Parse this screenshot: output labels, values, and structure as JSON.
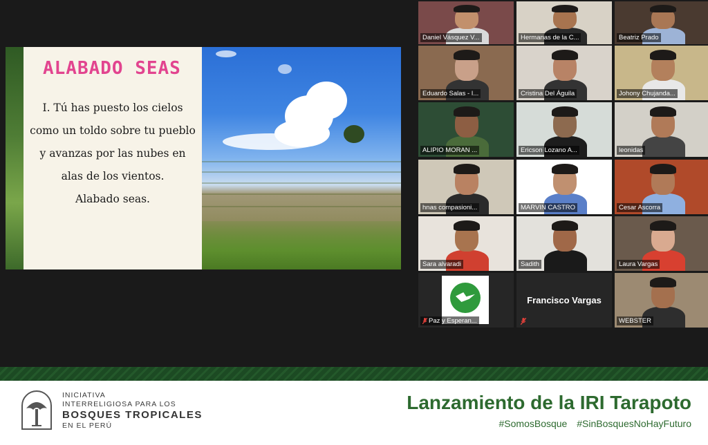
{
  "slide": {
    "title": "ALABADO SEAS",
    "verse_lines": [
      "I. Tú has puesto los cielos",
      "como un toldo sobre tu pueblo",
      "y avanzas por las nubes en",
      "alas de los vientos.",
      "Alabado seas."
    ]
  },
  "participants": [
    {
      "name": "Daniel Vásquez V...",
      "muted": false
    },
    {
      "name": "Hermanas de la C...",
      "muted": false
    },
    {
      "name": "Beatriz Prado",
      "muted": false
    },
    {
      "name": "Eduardo Salas - I...",
      "muted": false
    },
    {
      "name": "Cristina Del Águila",
      "muted": false
    },
    {
      "name": "Johony Chujanda...",
      "muted": false
    },
    {
      "name": "ALIPIO MORAN ...",
      "muted": false
    },
    {
      "name": "Ericson Lozano A...",
      "muted": false
    },
    {
      "name": "leonidas",
      "muted": false
    },
    {
      "name": "hnas compasioni...",
      "muted": false
    },
    {
      "name": "MARVIN CASTRO",
      "muted": false
    },
    {
      "name": "Cesar Ascorra",
      "muted": false
    },
    {
      "name": "Sara alvaradi",
      "muted": false
    },
    {
      "name": "Sadith",
      "muted": false,
      "active_speaker": true
    },
    {
      "name": "Laura Vargas",
      "muted": false
    },
    {
      "name": "Paz y Esperan...",
      "muted": true
    },
    {
      "name": "Francisco Vargas",
      "muted": true,
      "video_off": true
    },
    {
      "name": "WEBSTER",
      "muted": false
    }
  ],
  "banner": {
    "org_lines": [
      "INICIATIVA",
      "INTERRELIGIOSA PARA LOS",
      "BOSQUES TROPICALES",
      "EN EL PERÚ"
    ],
    "event_title": "Lanzamiento de la IRI Tarapoto",
    "hashtags": [
      "#SomosBosque",
      "#SinBosquesNoHayFuturo"
    ]
  },
  "colors": {
    "slide_title": "#e2448f",
    "brand_green": "#2d6a2f",
    "active_speaker_border": "#d6d66a",
    "mute_icon": "#e0403a"
  },
  "icons": {
    "mute": "muted-microphone-icon",
    "logo": "tree-logo-icon"
  }
}
